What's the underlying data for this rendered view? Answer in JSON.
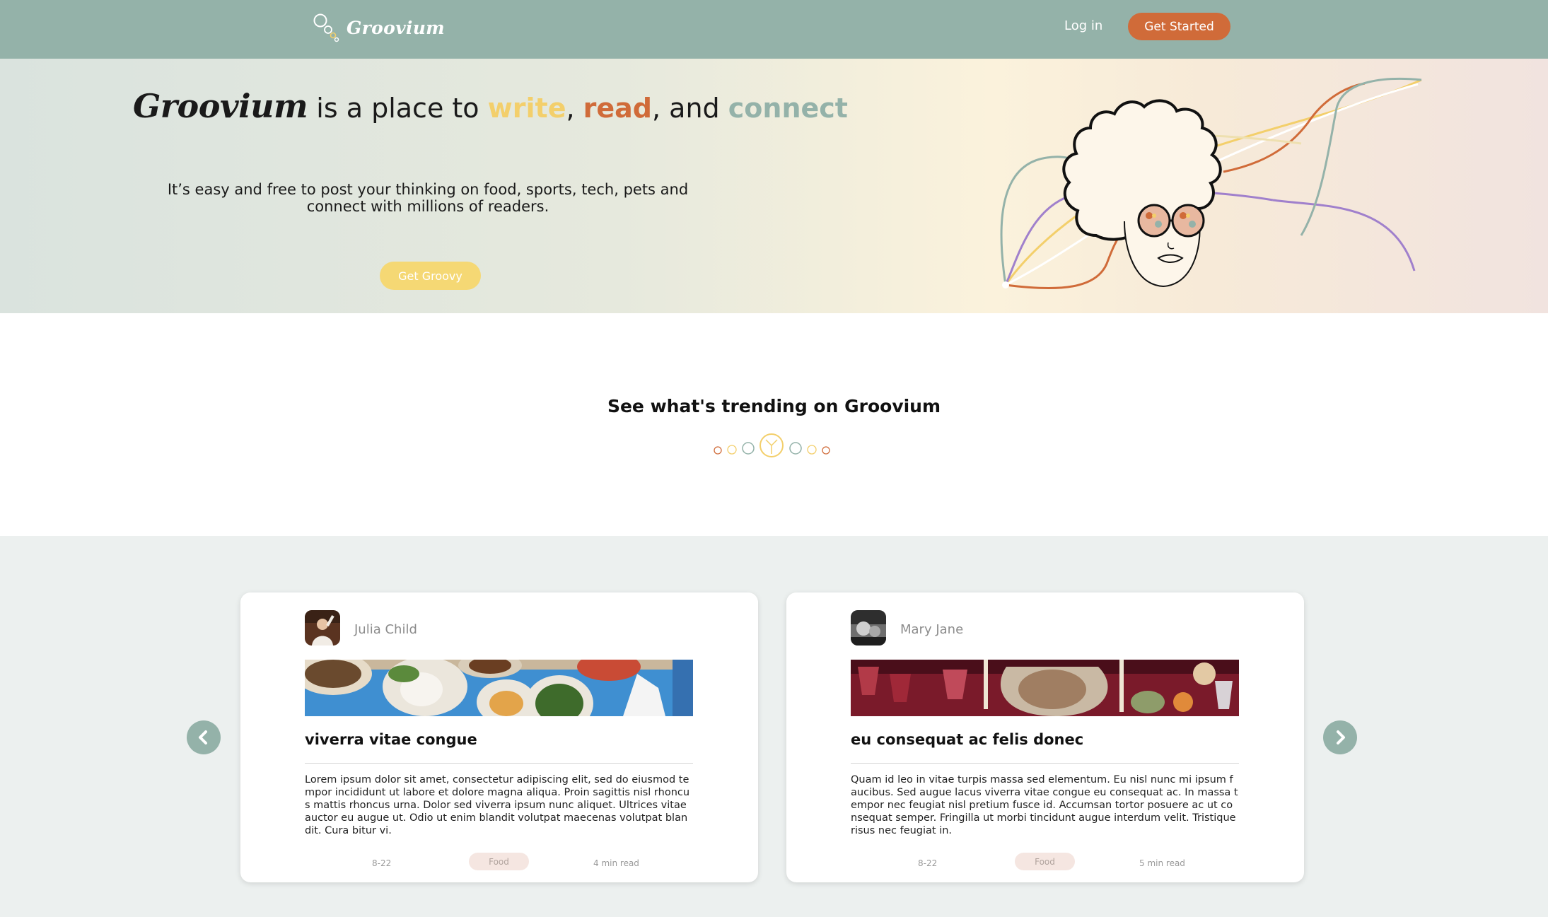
{
  "nav": {
    "brand": "Groovium",
    "login_label": "Log in",
    "cta_label": "Get Started"
  },
  "hero": {
    "brand": "Groovium",
    "title_part1": "is a place to",
    "word_write": "write",
    "sep1": ",",
    "word_read": "read",
    "sep2": ", and",
    "word_connect": "connect",
    "subtitle": "It’s easy and free to post your thinking on food, sports, tech, pets and connect with millions of readers.",
    "cta_label": "Get Groovy"
  },
  "trending": {
    "title": "See what's trending on Groovium"
  },
  "cards": [
    {
      "author": "Julia Child",
      "title": "viverra vitae congue",
      "body": "Lorem ipsum dolor sit amet, consectetur adipiscing elit, sed do eiusmod tempor incididunt ut labore et dolore magna aliqua. Proin sagittis nisl rhoncus mattis rhoncus urna. Dolor sed viverra ipsum nunc aliquet. Ultrices vitae auctor eu augue ut. Odio ut enim blandit volutpat maecenas volutpat blandit. Cura bitur vi.",
      "date": "8-22",
      "tag": "Food",
      "read_time": "4 min read"
    },
    {
      "author": "Mary Jane",
      "title": "eu consequat ac felis donec",
      "body": "Quam id leo in vitae turpis massa sed elementum. Eu nisl nunc mi ipsum faucibus. Sed augue lacus viverra vitae congue eu consequat ac. In massa tempor nec feugiat nisl pretium fusce id. Accumsan tortor posuere ac ut consequat semper. Fringilla ut morbi tincidunt augue interdum velit. Tristique risus nec feugiat in.",
      "date": "8-22",
      "tag": "Food",
      "read_time": "5 min read"
    }
  ],
  "colors": {
    "nav_bg": "#94b2a9",
    "accent_orange": "#d06b39",
    "accent_yellow": "#f3cf6b",
    "accent_sage": "#94b2a9"
  },
  "icons": {
    "logo": "bubbles-logo-icon",
    "prev": "chevron-left-icon",
    "next": "chevron-right-icon"
  }
}
